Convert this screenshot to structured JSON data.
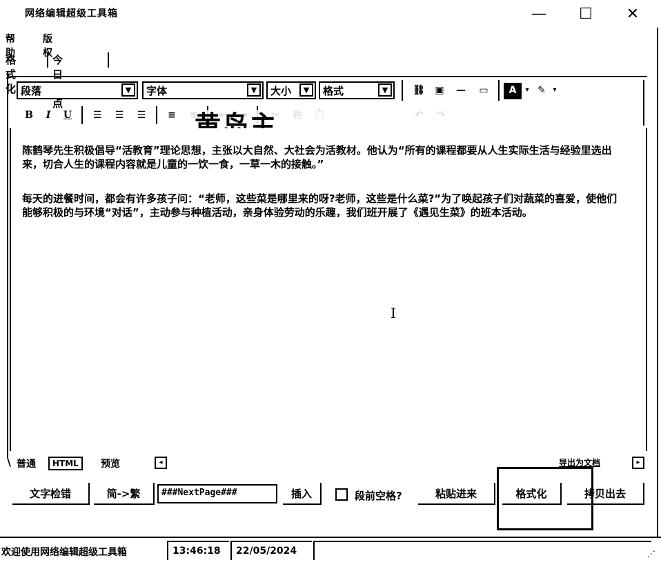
{
  "window": {
    "title": "网络编辑超级工具箱",
    "minimize": "—",
    "maximize": "☐",
    "close": "✕"
  },
  "menubar": {
    "items": [
      "帮助",
      "版权"
    ]
  },
  "top_tabs": [
    "格式化",
    "今日焦点"
  ],
  "toolbar": {
    "paragraph": "段落",
    "font": "字体",
    "size": "大小",
    "format": "格式",
    "bold": "B",
    "italic": "I",
    "underline": "U"
  },
  "editor": {
    "paragraphs": [
      "陈鹤琴先生积极倡导“活教育”理论思想，主张以大自然、大社会为活教材。他认为“所有的课程都要从人生实际生活与经验里选出来，切合人生的课程内容就是儿童的一饮一食，一草一木的接触。”",
      "每天的进餐时间，都会有许多孩子问：“老师，这些菜是哪里来的呀?老师，这些是什么菜?”为了唤起孩子们对蔬菜的喜爱，使他们能够积极的与环境“对话”，主动参与种植活动，亲身体验劳动的乐趣，我们班开展了《遇见生菜》的班本活动。"
    ],
    "overlay_text": "黄岛主"
  },
  "bottom_tabs": [
    "普通",
    "HTML",
    "预览"
  ],
  "bottom_right_link": "导出为文档",
  "buttons": {
    "spellcheck": "文字检错",
    "convert": "简->繁",
    "insert": "插入",
    "indent_label": "段前空格?",
    "paste": "粘贴进来",
    "format": "格式化",
    "copy_out": "拷贝出去"
  },
  "pagebreak_input": {
    "value": "###NextPage###"
  },
  "status": {
    "welcome": "欢迎使用网络编辑超级工具箱",
    "time": "13:46:18",
    "date": "22/05/2024"
  }
}
